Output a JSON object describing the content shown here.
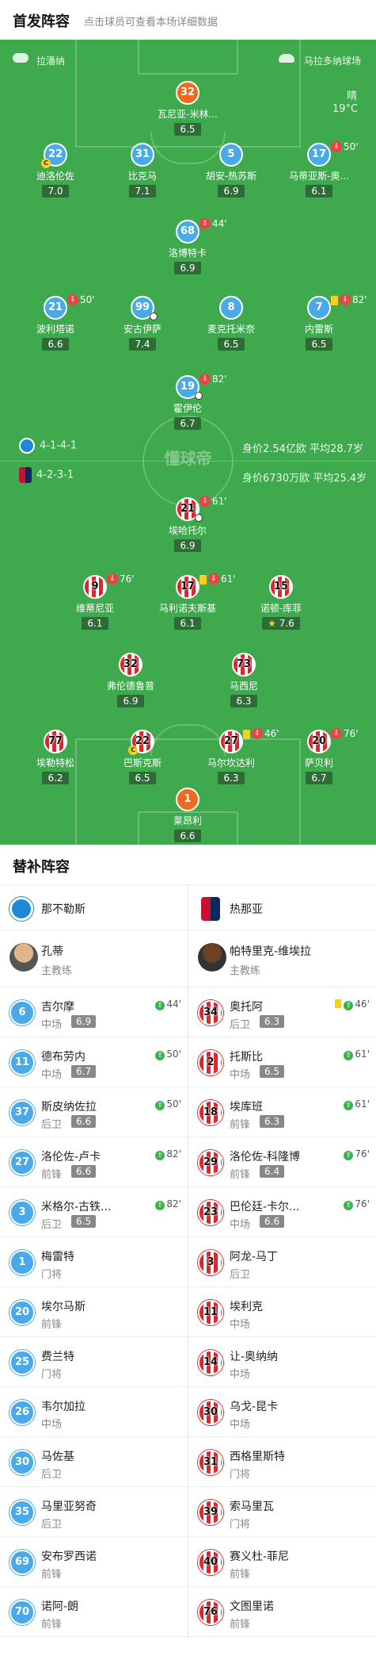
{
  "header": {
    "title": "首发阵容",
    "subtitle": "点击球员可查看本场详细数据"
  },
  "pitch": {
    "referee_left": "拉潘纳",
    "referee_right": "马拉多纳球场",
    "weather": "晴",
    "temp": "19°C",
    "watermark": "懂球帝",
    "home_formation": "4-1-4-1",
    "home_value": "身价2.54亿欧",
    "home_age": "平均28.7岁",
    "away_formation": "4-2-3-1",
    "away_value": "身价6730万欧",
    "away_age": "平均25.4岁"
  },
  "home_players": [
    {
      "num": "32",
      "name": "瓦尼亚-米林...",
      "rating": "6.5",
      "gk": true
    },
    {
      "num": "22",
      "name": "迪洛伦佐",
      "rating": "7.0",
      "captain": true
    },
    {
      "num": "31",
      "name": "比克马",
      "rating": "7.1"
    },
    {
      "num": "5",
      "name": "胡安-热苏斯",
      "rating": "6.9"
    },
    {
      "num": "17",
      "name": "马蒂亚斯-奥...",
      "rating": "6.1",
      "sub": "50'"
    },
    {
      "num": "68",
      "name": "洛博特卡",
      "rating": "6.9",
      "sub": "44'"
    },
    {
      "num": "21",
      "name": "波利塔诺",
      "rating": "6.6",
      "sub": "50'"
    },
    {
      "num": "99",
      "name": "安古伊萨",
      "rating": "7.4",
      "goal": true
    },
    {
      "num": "8",
      "name": "麦克托米奈",
      "rating": "6.5"
    },
    {
      "num": "7",
      "name": "内雷斯",
      "rating": "6.5",
      "sub": "82'",
      "yellow": true
    },
    {
      "num": "19",
      "name": "霍伊伦",
      "rating": "6.7",
      "sub": "82'",
      "goal": true
    }
  ],
  "away_players": [
    {
      "num": "21",
      "name": "埃哈托尔",
      "rating": "6.9",
      "sub": "61'",
      "goal": true
    },
    {
      "num": "9",
      "name": "维蒂尼亚",
      "rating": "6.1",
      "sub": "76'"
    },
    {
      "num": "17",
      "name": "马利诺夫斯基",
      "rating": "6.1",
      "sub": "61'",
      "yellow": true
    },
    {
      "num": "15",
      "name": "诺顿-库菲",
      "rating": "7.6",
      "star": true
    },
    {
      "num": "32",
      "name": "弗伦德鲁普",
      "rating": "6.9"
    },
    {
      "num": "73",
      "name": "马西尼",
      "rating": "6.3"
    },
    {
      "num": "77",
      "name": "埃勒特松",
      "rating": "6.2"
    },
    {
      "num": "22",
      "name": "巴斯克斯",
      "rating": "6.5",
      "captain": true
    },
    {
      "num": "27",
      "name": "马尔坎达利",
      "rating": "6.3",
      "sub": "46'",
      "yellow": true
    },
    {
      "num": "20",
      "name": "萨贝利",
      "rating": "6.7",
      "sub": "76'"
    },
    {
      "num": "1",
      "name": "莱昂利",
      "rating": "6.6",
      "gk": true
    }
  ],
  "subs": {
    "title": "替补阵容",
    "home": {
      "team": "那不勒斯",
      "coach": "孔蒂",
      "coach_role": "主教练",
      "players": [
        {
          "num": "6",
          "name": "吉尔摩",
          "pos": "中场",
          "rating": "6.9",
          "in": "44'"
        },
        {
          "num": "11",
          "name": "德布劳内",
          "pos": "中场",
          "rating": "6.7",
          "in": "50'"
        },
        {
          "num": "37",
          "name": "斯皮纳佐拉",
          "pos": "后卫",
          "rating": "6.6",
          "in": "50'"
        },
        {
          "num": "27",
          "name": "洛伦佐-卢卡",
          "pos": "前锋",
          "rating": "6.6",
          "in": "82'"
        },
        {
          "num": "3",
          "name": "米格尔-古铁...",
          "pos": "后卫",
          "rating": "6.5",
          "in": "82'"
        },
        {
          "num": "1",
          "name": "梅雷特",
          "pos": "门将"
        },
        {
          "num": "20",
          "name": "埃尔马斯",
          "pos": "前锋"
        },
        {
          "num": "25",
          "name": "费兰特",
          "pos": "门将"
        },
        {
          "num": "26",
          "name": "韦尔加拉",
          "pos": "中场"
        },
        {
          "num": "30",
          "name": "马佐基",
          "pos": "后卫"
        },
        {
          "num": "35",
          "name": "马里亚努奇",
          "pos": "后卫"
        },
        {
          "num": "69",
          "name": "安布罗西诺",
          "pos": "前锋"
        },
        {
          "num": "70",
          "name": "诺阿-朗",
          "pos": "前锋"
        }
      ]
    },
    "away": {
      "team": "热那亚",
      "coach": "帕特里克-维埃拉",
      "coach_role": "主教练",
      "players": [
        {
          "num": "34",
          "name": "奥托阿",
          "pos": "后卫",
          "rating": "6.3",
          "in": "46'",
          "yellow": true
        },
        {
          "num": "2",
          "name": "托斯比",
          "pos": "中场",
          "rating": "6.5",
          "in": "61'"
        },
        {
          "num": "18",
          "name": "埃库班",
          "pos": "前锋",
          "rating": "6.3",
          "in": "61'"
        },
        {
          "num": "29",
          "name": "洛伦佐-科隆博",
          "pos": "前锋",
          "rating": "6.4",
          "in": "76'"
        },
        {
          "num": "23",
          "name": "巴伦廷-卡尔...",
          "pos": "中场",
          "rating": "6.6",
          "in": "76'"
        },
        {
          "num": "3",
          "name": "阿龙-马丁",
          "pos": "后卫"
        },
        {
          "num": "11",
          "name": "埃利克",
          "pos": "中场"
        },
        {
          "num": "14",
          "name": "让-奥纳纳",
          "pos": "中场"
        },
        {
          "num": "30",
          "name": "乌戈-昆卡",
          "pos": "中场"
        },
        {
          "num": "31",
          "name": "西格里斯特",
          "pos": "门将"
        },
        {
          "num": "39",
          "name": "索马里瓦",
          "pos": "门将"
        },
        {
          "num": "40",
          "name": "赛义杜-菲尼",
          "pos": "前锋"
        },
        {
          "num": "76",
          "name": "文图里诺",
          "pos": "前锋"
        }
      ]
    }
  }
}
